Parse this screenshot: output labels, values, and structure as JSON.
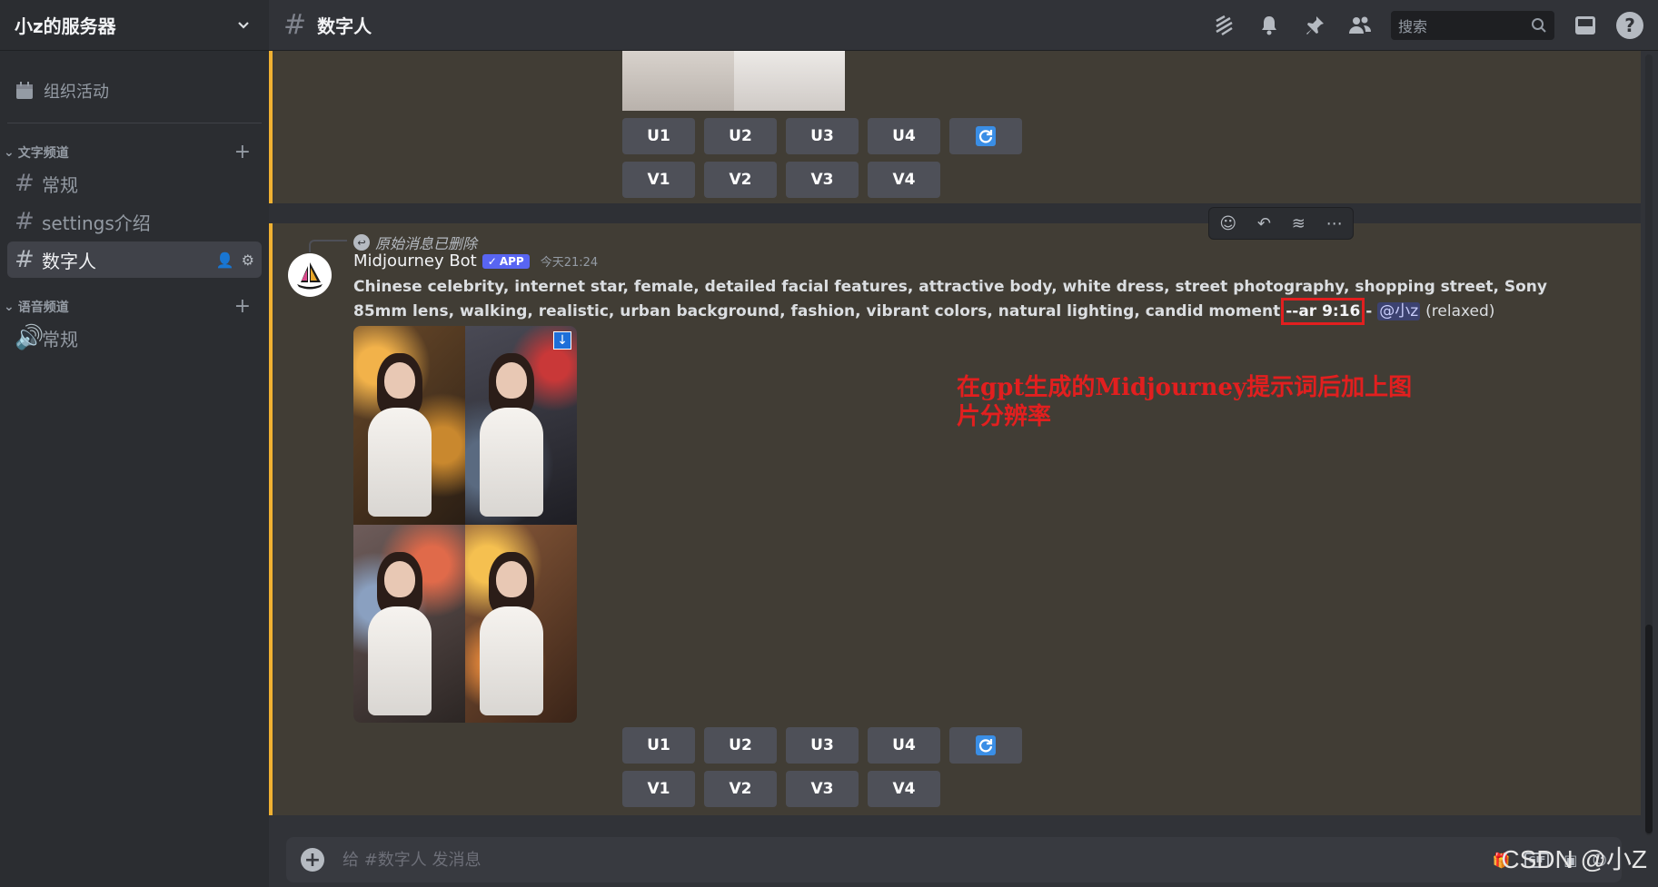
{
  "server": {
    "name": "小z的服务器"
  },
  "sidebar": {
    "events_label": "组织活动",
    "categories": [
      {
        "name": "文字频道",
        "channels": [
          "常规",
          "settings介绍",
          "数字人"
        ]
      },
      {
        "name": "语音频道",
        "channels": [
          "常规"
        ]
      }
    ]
  },
  "topbar": {
    "channel": "数字人",
    "search_placeholder": "搜索"
  },
  "buttons": {
    "upscale": [
      "U1",
      "U2",
      "U3",
      "U4"
    ],
    "variation": [
      "V1",
      "V2",
      "V3",
      "V4"
    ]
  },
  "message": {
    "reply_text": "原始消息已删除",
    "author": "Midjourney Bot",
    "badge": "APP",
    "timestamp": "今天21:24",
    "prompt": "Chinese celebrity, internet star, female, detailed facial features, attractive body, white dress, street photography, shopping street, Sony 85mm lens, walking, realistic, urban background, fashion, vibrant colors, natural lighting, candid moment",
    "param": "--ar 9:16",
    "separator": " - ",
    "mention": "@小z",
    "mode": "(relaxed)"
  },
  "annotation": {
    "line1": "在gpt生成的Midjourney提示词后加上图",
    "line2": "片分辨率"
  },
  "composer": {
    "placeholder": "给 #数字人 发消息"
  },
  "watermark": "CSDN @小Z",
  "colors": {
    "accent": "#f0b132",
    "brand": "#5865f2",
    "annotation": "#e21f1f"
  }
}
